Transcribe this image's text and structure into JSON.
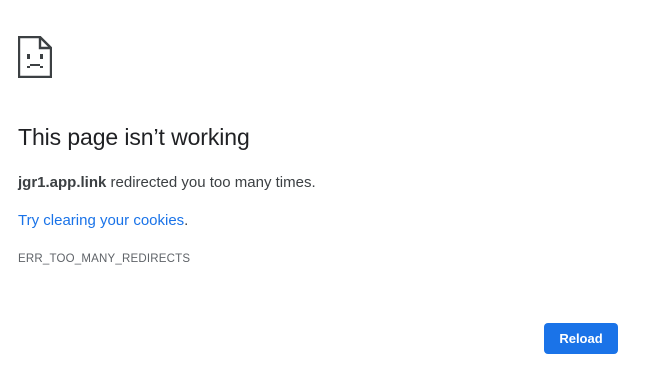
{
  "error_page": {
    "icon": "sad-page-icon",
    "title": "This page isn’t working",
    "summary": {
      "host": "jgr1.app.link",
      "message": " redirected you too many times."
    },
    "suggestion": {
      "link_text": "Try clearing your cookies",
      "suffix": "."
    },
    "error_code": "ERR_TOO_MANY_REDIRECTS",
    "reload_label": "Reload"
  },
  "colors": {
    "accent": "#1a73e8",
    "text": "#202124",
    "secondary_text": "#5f6368"
  }
}
